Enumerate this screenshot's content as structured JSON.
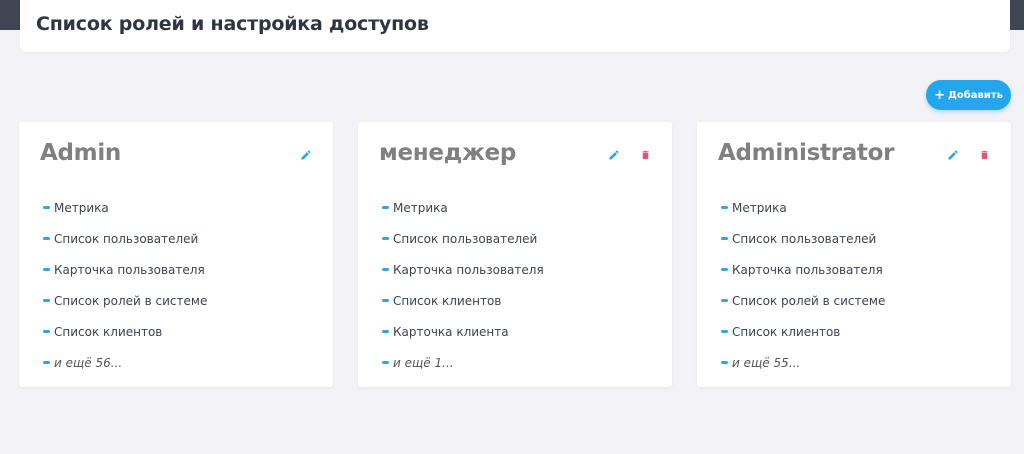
{
  "page": {
    "title": "Список ролей и настройка доступов"
  },
  "toolbar": {
    "add_label": "Добавить"
  },
  "colors": {
    "accent": "#23a6ec",
    "delete": "#e2547a",
    "role_name": "#808080"
  },
  "roles": [
    {
      "name": "Admin",
      "permissions": [
        "Метрика",
        "Список пользователей",
        "Карточка пользователя",
        "Список ролей в системе",
        "Список клиентов"
      ],
      "more": "и ещё 56..."
    },
    {
      "name": "менеджер",
      "permissions": [
        "Метрика",
        "Список пользователей",
        "Карточка пользователя",
        "Список клиентов",
        "Карточка клиента"
      ],
      "more": "и ещё 1..."
    },
    {
      "name": "Administrator",
      "permissions": [
        "Метрика",
        "Список пользователей",
        "Карточка пользователя",
        "Список ролей в системе",
        "Список клиентов"
      ],
      "more": "и ещё 55..."
    }
  ]
}
